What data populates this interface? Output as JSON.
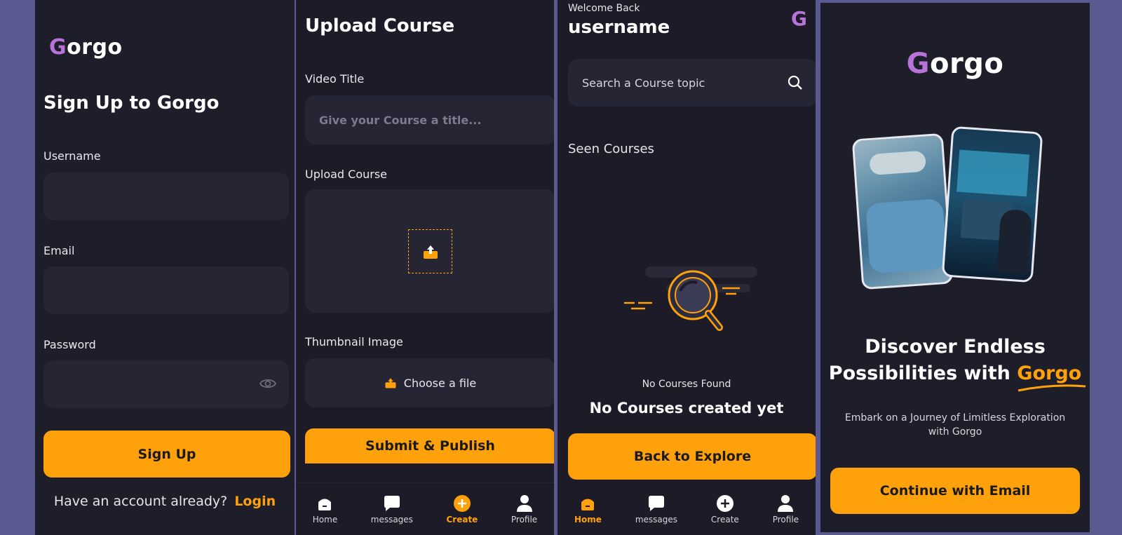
{
  "signup": {
    "logo_text": "orgo",
    "title": "Sign Up to Gorgo",
    "username_label": "Username",
    "email_label": "Email",
    "password_label": "Password",
    "signup_button": "Sign Up",
    "have_account_text": "Have an account already?",
    "login_link": "Login"
  },
  "upload": {
    "title": "Upload Course",
    "video_title_label": "Video Title",
    "video_title_placeholder": "Give your Course a title...",
    "upload_course_label": "Upload Course",
    "thumbnail_label": "Thumbnail Image",
    "choose_file": "Choose a file",
    "submit_button": "Submit & Publish",
    "nav": [
      {
        "label": "Home",
        "icon": "home-icon"
      },
      {
        "label": "messages",
        "icon": "message-icon"
      },
      {
        "label": "Create",
        "icon": "plus-circle-icon"
      },
      {
        "label": "Profile",
        "icon": "profile-icon"
      }
    ]
  },
  "home": {
    "welcome": "Welcome Back",
    "username": "username",
    "search_placeholder": "Search a Course topic",
    "seen_courses": "Seen Courses",
    "no_courses_found": "No Courses Found",
    "no_courses_created": "No Courses created yet",
    "back_button": "Back to Explore",
    "nav": [
      {
        "label": "Home",
        "icon": "home-icon"
      },
      {
        "label": "messages",
        "icon": "message-icon"
      },
      {
        "label": "Create",
        "icon": "plus-circle-icon"
      },
      {
        "label": "Profile",
        "icon": "profile-icon"
      }
    ]
  },
  "onboarding": {
    "logo_text": "orgo",
    "headline_line1": "Discover Endless",
    "headline_line2": "Possibilities with",
    "headline_brand": "Gorgo",
    "subtitle": "Embark on a Journey of Limitless Exploration with Gorgo",
    "continue_button": "Continue with Email"
  },
  "colors": {
    "accent": "#ffa10a",
    "background": "#5a5a91",
    "panel": "#1e1d2a",
    "field": "#262533",
    "logo_purple": "#b873d9"
  }
}
